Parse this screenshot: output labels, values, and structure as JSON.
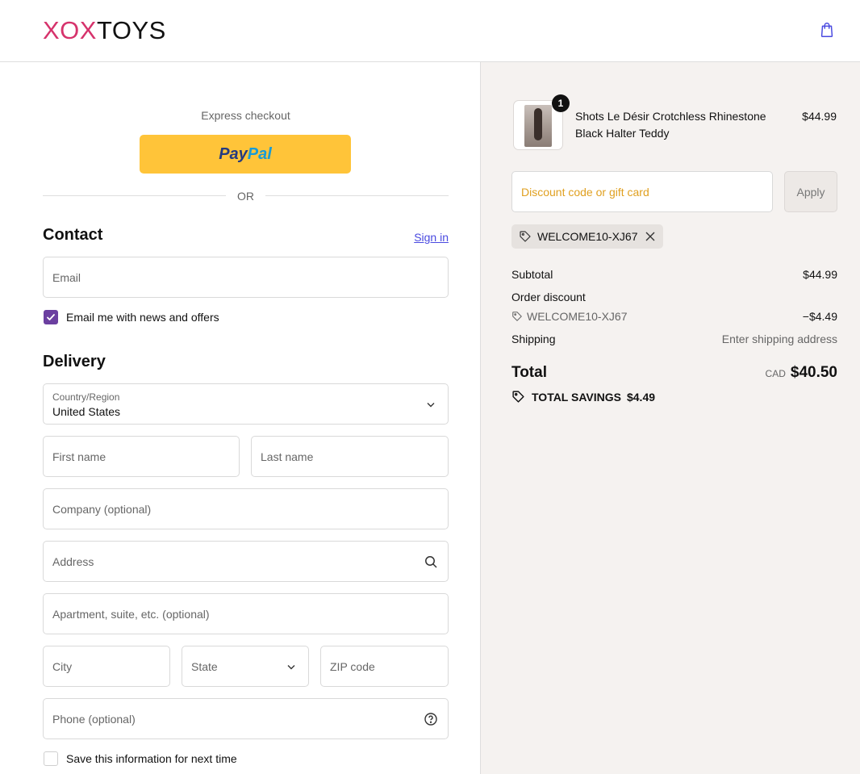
{
  "header": {
    "logo_mark": "XOX",
    "logo_word": "TOYS",
    "cart_icon": "shopping-bag-icon"
  },
  "express": {
    "label": "Express checkout",
    "paypal_part1": "Pay",
    "paypal_part2": "Pal",
    "or_text": "OR"
  },
  "contact": {
    "heading": "Contact",
    "sign_in": "Sign in",
    "email_placeholder": "Email",
    "newsletter_label": "Email me with news and offers",
    "newsletter_checked": true
  },
  "delivery": {
    "heading": "Delivery",
    "country_label": "Country/Region",
    "country_value": "United States",
    "first_name": "First name",
    "last_name": "Last name",
    "company": "Company (optional)",
    "address": "Address",
    "apartment": "Apartment, suite, etc. (optional)",
    "city": "City",
    "state": "State",
    "zip": "ZIP code",
    "phone": "Phone (optional)",
    "save_info_label": "Save this information for next time",
    "save_info_checked": false
  },
  "summary": {
    "item": {
      "quantity": "1",
      "title": "Shots Le Désir Crotchless Rhinestone Black Halter Teddy",
      "price": "$44.99"
    },
    "discount_placeholder": "Discount code or gift card",
    "apply_label": "Apply",
    "applied_code": "WELCOME10-XJ67",
    "subtotal_label": "Subtotal",
    "subtotal_value": "$44.99",
    "order_discount_label": "Order discount",
    "discount_code": "WELCOME10-XJ67",
    "discount_value": "−$4.49",
    "shipping_label": "Shipping",
    "shipping_value": "Enter shipping address",
    "total_label": "Total",
    "currency": "CAD",
    "total_value": "$40.50",
    "savings_label": "TOTAL SAVINGS",
    "savings_value": "$4.49"
  },
  "colors": {
    "brand_pink": "#d6336c",
    "checkbox_purple": "#6b3fa0",
    "paypal_yellow": "#ffc439",
    "summary_bg": "#f5f2f0"
  }
}
